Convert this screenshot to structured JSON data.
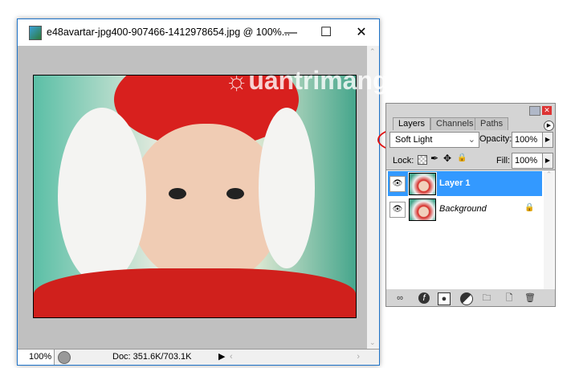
{
  "document": {
    "title": "e48avartar-jpg400-907466-1412978654.jpg @ 100%...",
    "zoom": "100%",
    "doc_size": "Doc: 351.6K/703.1K",
    "watermark": "Quantrimang"
  },
  "layers_panel": {
    "tabs": [
      "Layers",
      "Channels",
      "Paths"
    ],
    "blend_mode": "Soft Light",
    "opacity_label": "Opacity:",
    "opacity": "100%",
    "lock_label": "Lock:",
    "fill_label": "Fill:",
    "fill": "100%",
    "layers": [
      {
        "name": "Layer 1",
        "selected": true
      },
      {
        "name": "Background",
        "locked": true
      }
    ]
  },
  "colors": {
    "selection": "#3399ff",
    "highlight_ring": "#e01010"
  }
}
